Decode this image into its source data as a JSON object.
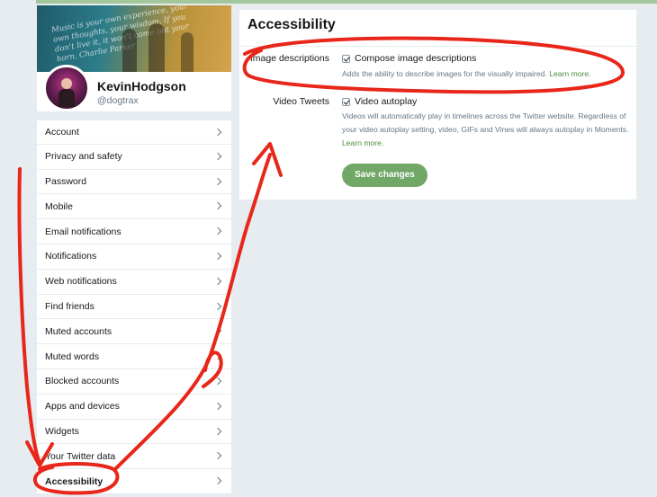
{
  "profile": {
    "banner_quote": "Music is your own experience, your own thoughts, your wisdom. If you don't live it, it won't come out your horn. Charlie Parker",
    "name": "KevinHodgson",
    "handle": "@dogtrax"
  },
  "nav": {
    "items": [
      {
        "label": "Account"
      },
      {
        "label": "Privacy and safety"
      },
      {
        "label": "Password"
      },
      {
        "label": "Mobile"
      },
      {
        "label": "Email notifications"
      },
      {
        "label": "Notifications"
      },
      {
        "label": "Web notifications"
      },
      {
        "label": "Find friends"
      },
      {
        "label": "Muted accounts"
      },
      {
        "label": "Muted words"
      },
      {
        "label": "Blocked accounts"
      },
      {
        "label": "Apps and devices"
      },
      {
        "label": "Widgets"
      },
      {
        "label": "Your Twitter data"
      },
      {
        "label": "Accessibility"
      }
    ],
    "active": "Accessibility"
  },
  "main": {
    "title": "Accessibility",
    "image_descriptions": {
      "label": "Image descriptions",
      "option": "Compose image descriptions",
      "checked": true,
      "help": "Adds the ability to describe images for the visually impaired.",
      "link": "Learn more."
    },
    "video_tweets": {
      "label": "Video Tweets",
      "option": "Video autoplay",
      "checked": true,
      "help": "Videos will automatically play in timelines across the Twitter website. Regardless of your video autoplay setting, video, GIFs and Vines will always autoplay in Moments.",
      "link": "Learn more."
    },
    "save_label": "Save changes"
  },
  "colors": {
    "accent": "#72a867",
    "link": "#4c8a3a",
    "annotation": "#e8261a",
    "background": "#e6ecf0"
  }
}
